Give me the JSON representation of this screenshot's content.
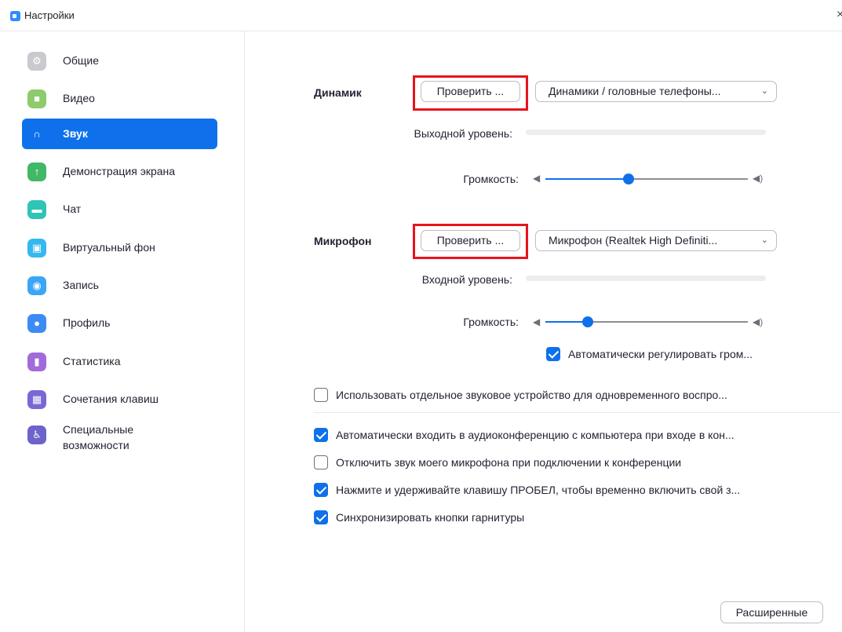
{
  "window": {
    "title": "Настройки",
    "close_glyph": "×"
  },
  "sidebar": {
    "items": [
      {
        "label": "Общие",
        "icon": "gear-icon",
        "color": "#c9c9cf",
        "glyph": "⚙"
      },
      {
        "label": "Видео",
        "icon": "video-camera-icon",
        "color": "#8dcb6b",
        "glyph": "■"
      },
      {
        "label": "Звук",
        "icon": "headphones-icon",
        "color": "#0e71eb",
        "glyph": "∩"
      },
      {
        "label": "Демонстрация экрана",
        "icon": "share-screen-icon",
        "color": "#41b866",
        "glyph": "↑"
      },
      {
        "label": "Чат",
        "icon": "chat-icon",
        "color": "#2ec4b6",
        "glyph": "▬"
      },
      {
        "label": "Виртуальный фон",
        "icon": "virtual-background-icon",
        "color": "#35b8f0",
        "glyph": "▣"
      },
      {
        "label": "Запись",
        "icon": "record-icon",
        "color": "#3aa6f5",
        "glyph": "◉"
      },
      {
        "label": "Профиль",
        "icon": "profile-icon",
        "color": "#3d8cf5",
        "glyph": "●"
      },
      {
        "label": "Статистика",
        "icon": "statistics-icon",
        "color": "#a36ad9",
        "glyph": "▮"
      },
      {
        "label": "Сочетания клавиш",
        "icon": "keyboard-icon",
        "color": "#7a67d4",
        "glyph": "▦"
      },
      {
        "label": "Специальные возможности",
        "icon": "accessibility-icon",
        "color": "#6d63c9",
        "glyph": "♿"
      }
    ]
  },
  "speaker": {
    "label": "Динамик",
    "test_button": "Проверить ...",
    "device": "Динамики / головные телефоны...",
    "output_level_label": "Выходной уровень:",
    "volume_label": "Громкость:",
    "volume_fraction": 0.41
  },
  "microphone": {
    "label": "Микрофон",
    "test_button": "Проверить ...",
    "device": "Микрофон (Realtek High Definiti...",
    "input_level_label": "Входной уровень:",
    "volume_label": "Громкость:",
    "volume_fraction": 0.21,
    "auto_adjust_label": "Автоматически регулировать гром...",
    "auto_adjust_checked": true
  },
  "options": {
    "separate_device": {
      "label": "Использовать отдельное звуковое устройство для одновременного воспро...",
      "checked": false
    },
    "auto_join_audio": {
      "label": "Автоматически входить в аудиоконференцию с компьютера при входе в кон...",
      "checked": true
    },
    "mute_on_join": {
      "label": "Отключить звук моего микрофона при подключении к конференции",
      "checked": false
    },
    "space_unmute": {
      "label": "Нажмите и удерживайте клавишу ПРОБЕЛ, чтобы временно включить свой з...",
      "checked": true
    },
    "sync_headset": {
      "label": "Синхронизировать кнопки гарнитуры",
      "checked": true
    }
  },
  "advanced_button": "Расширенные",
  "colors": {
    "accent": "#0e71eb",
    "highlight_box": "#e8141c"
  }
}
